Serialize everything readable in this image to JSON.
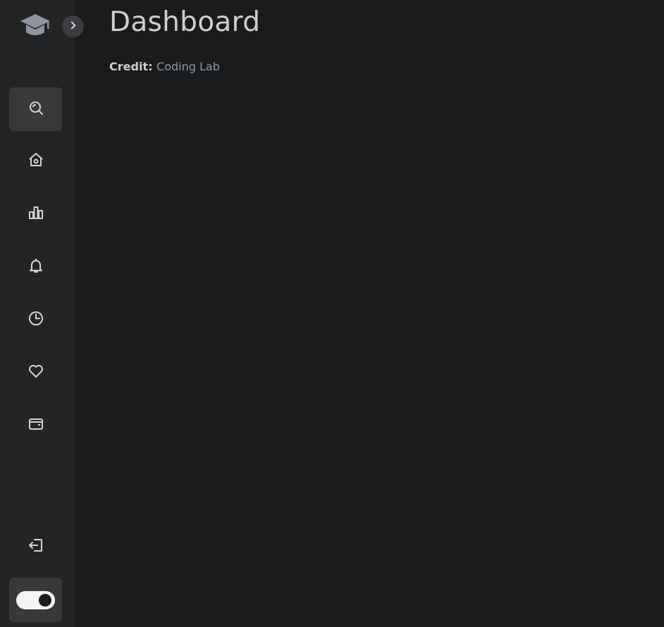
{
  "page": {
    "title": "Dashboard"
  },
  "credit": {
    "label": "Credit:",
    "link_text": "Coding Lab"
  },
  "sidebar": {
    "items": [
      {
        "icon": "search-icon",
        "active": true
      },
      {
        "icon": "home-icon",
        "active": false
      },
      {
        "icon": "bar-chart-icon",
        "active": false
      },
      {
        "icon": "bell-icon",
        "active": false
      },
      {
        "icon": "pie-chart-icon",
        "active": false
      },
      {
        "icon": "heart-icon",
        "active": false
      },
      {
        "icon": "wallet-icon",
        "active": false
      }
    ],
    "logout_icon": "logout-icon",
    "dark_mode": {
      "icon": "toggle-switch",
      "on": true
    }
  },
  "colors": {
    "background": "#1a1b1d",
    "sidebar": "#232426",
    "active_item": "#38393b",
    "icon": "#d4d4d4",
    "link": "#8f98a2"
  }
}
